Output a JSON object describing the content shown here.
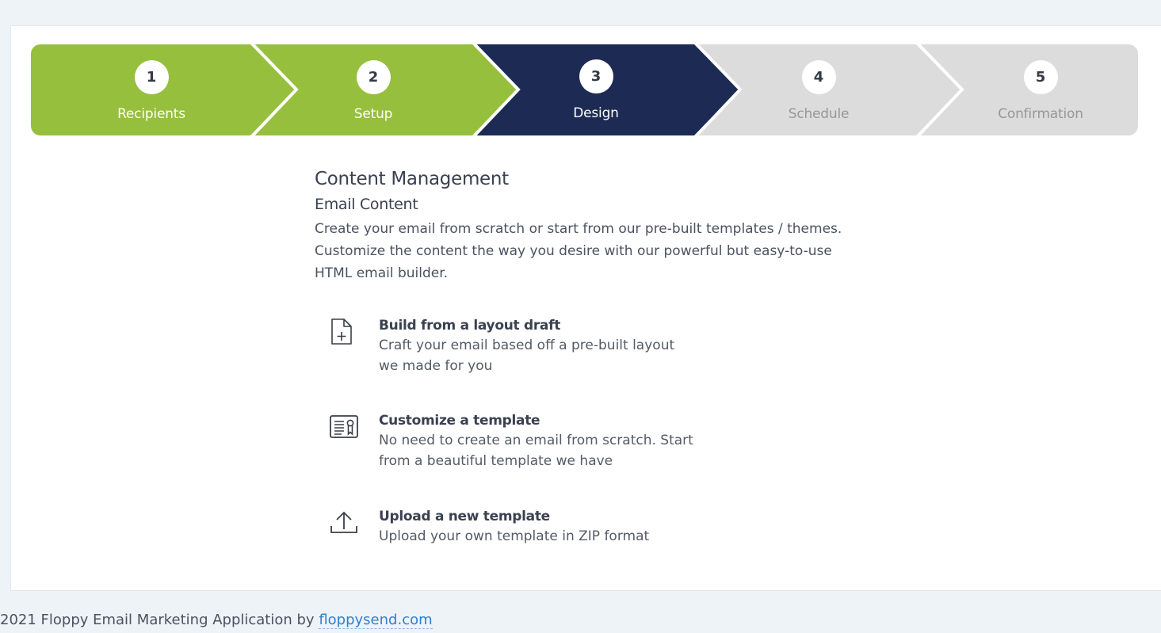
{
  "stepper": {
    "colors": {
      "done": "#97bf3e",
      "active": "#1d2b54",
      "todo": "#dcdcdc"
    },
    "steps": [
      {
        "number": "1",
        "label": "Recipients",
        "state": "done"
      },
      {
        "number": "2",
        "label": "Setup",
        "state": "done"
      },
      {
        "number": "3",
        "label": "Design",
        "state": "active"
      },
      {
        "number": "4",
        "label": "Schedule",
        "state": "todo"
      },
      {
        "number": "5",
        "label": "Confirmation",
        "state": "todo"
      }
    ]
  },
  "content": {
    "title": "Content Management",
    "subtitle": "Email Content",
    "description": "Create your email from scratch or start from our pre-built templates / themes. Customize the content the way you desire with our powerful but easy-to-use HTML email builder.",
    "options": [
      {
        "icon": "file-plus-icon",
        "title": "Build from a layout draft",
        "description": "Craft your email based off a pre-built layout we made for you"
      },
      {
        "icon": "certificate-icon",
        "title": "Customize a template",
        "description": "No need to create an email from scratch. Start from a beautiful template we have"
      },
      {
        "icon": "upload-icon",
        "title": "Upload a new template",
        "description": "Upload your own template in ZIP format"
      }
    ]
  },
  "footer": {
    "text": "2021 Floppy Email Marketing Application by",
    "link_label": "floppysend.com"
  }
}
